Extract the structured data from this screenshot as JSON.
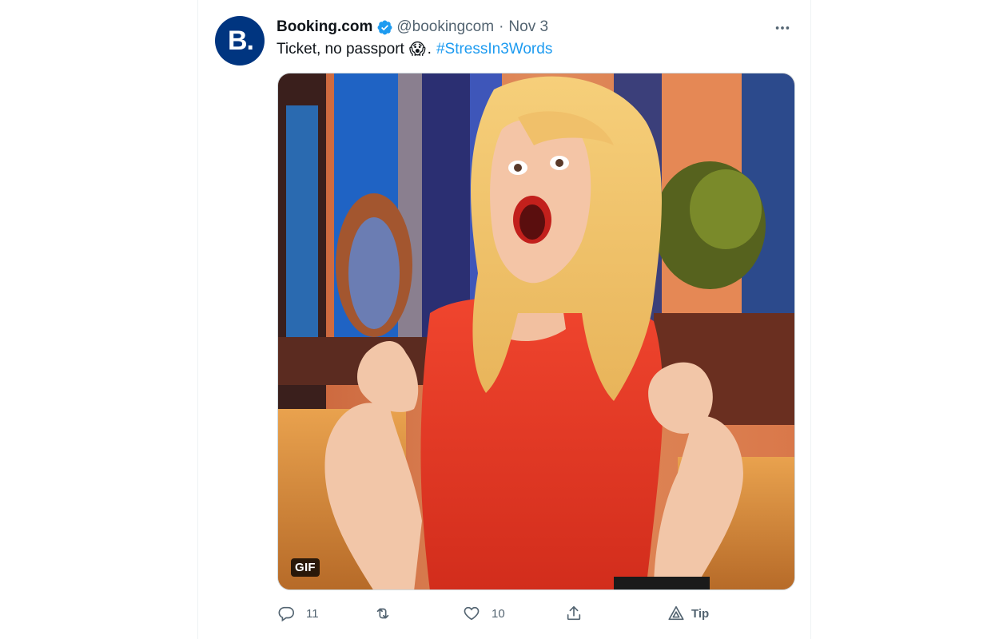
{
  "tweet": {
    "avatar_text": "B.",
    "display_name": "Booking.com",
    "handle": "@bookingcom",
    "separator": "·",
    "date": "Nov 3",
    "text": "Ticket, no passport",
    "emoji": "😱",
    "punctuation": ".",
    "hashtag": "#StressIn3Words"
  },
  "media": {
    "type_badge": "GIF"
  },
  "actions": {
    "reply_count": "11",
    "like_count": "10",
    "tip_label": "Tip"
  },
  "icons": {
    "verified": "verified-badge-icon",
    "more": "more-dots-icon",
    "reply": "reply-icon",
    "retweet": "retweet-icon",
    "like": "heart-icon",
    "share": "share-icon",
    "tip": "tip-icon"
  },
  "colors": {
    "brand_avatar": "#003580",
    "link": "#1d9bf0",
    "muted": "#536471",
    "verified": "#1d9bf0"
  }
}
